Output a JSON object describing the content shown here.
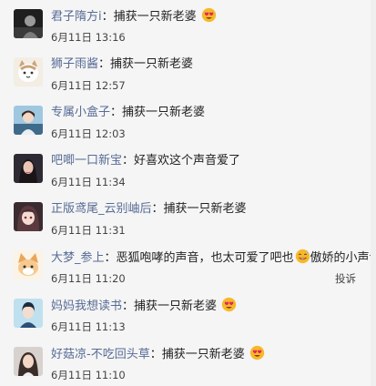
{
  "comments": [
    {
      "name": "君子隋方i",
      "text": "捕获一只新老婆",
      "emoji": "heart-eyes",
      "time": "6月11日 13:16",
      "avatar": "avatar-dark-figure"
    },
    {
      "name": "狮子雨酱",
      "text": "捕获一只新老婆",
      "emoji": "",
      "time": "6月11日 12:57",
      "avatar": "avatar-cat-cartoon"
    },
    {
      "name": "专属小盒子",
      "text": "捕获一只新老婆",
      "emoji": "",
      "time": "6月11日 12:03",
      "avatar": "avatar-girl-blue"
    },
    {
      "name": "吧唧一口新宝",
      "text": "好喜欢这个声音爱了",
      "emoji": "",
      "time": "6月11日 11:34",
      "avatar": "avatar-girl-dark"
    },
    {
      "name": "正版鸢尾_云别岫后",
      "text": "捕获一只新老婆",
      "emoji": "",
      "time": "6月11日 11:31",
      "avatar": "avatar-anime-girl"
    },
    {
      "name": "大梦_参上",
      "text": "恶狐咆哮的声音，也太可爱了吧也",
      "emoji": "sweat-smile",
      "text_after": "傲娇的小声音",
      "time": "6月11日 11:20",
      "avatar": "avatar-fox-cartoon",
      "report": "投诉"
    },
    {
      "name": "妈妈我想读书",
      "text": "捕获一只新老婆",
      "emoji": "heart-eyes",
      "time": "6月11日 11:13",
      "avatar": "avatar-anime-boy"
    },
    {
      "name": "好菇凉-不吃回头草",
      "text": "捕获一只新老婆",
      "emoji": "heart-eyes",
      "time": "6月11日 11:10",
      "avatar": "avatar-girl-photo"
    }
  ],
  "separator": "："
}
